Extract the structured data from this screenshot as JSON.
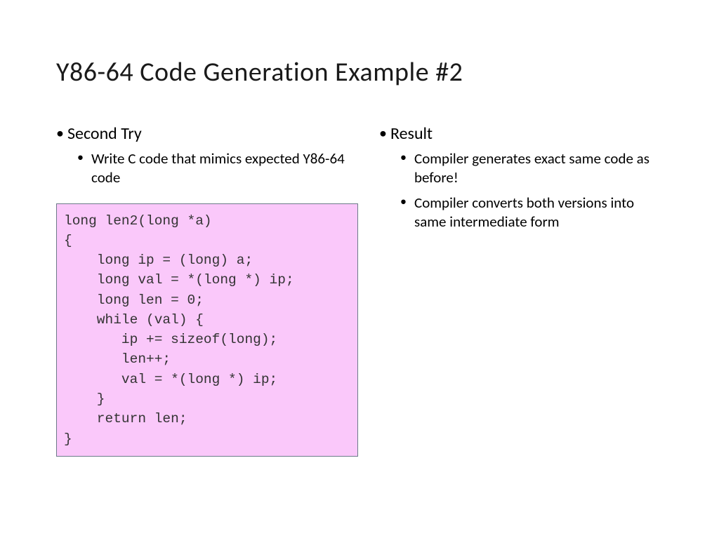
{
  "title": "Y86-64 Code Generation Example #2",
  "left": {
    "heading": "Second Try",
    "sub1": "Write C code that mimics expected Y86-64 code"
  },
  "right": {
    "heading": "Result",
    "sub1": "Compiler generates exact same code as before!",
    "sub2": "Compiler converts both versions into same intermediate form"
  },
  "code": "long len2(long *a)\n{\n    long ip = (long) a;\n    long val = *(long *) ip;\n    long len = 0;\n    while (val) {\n       ip += sizeof(long);\n       len++;\n       val = *(long *) ip;\n    }\n    return len;\n}"
}
